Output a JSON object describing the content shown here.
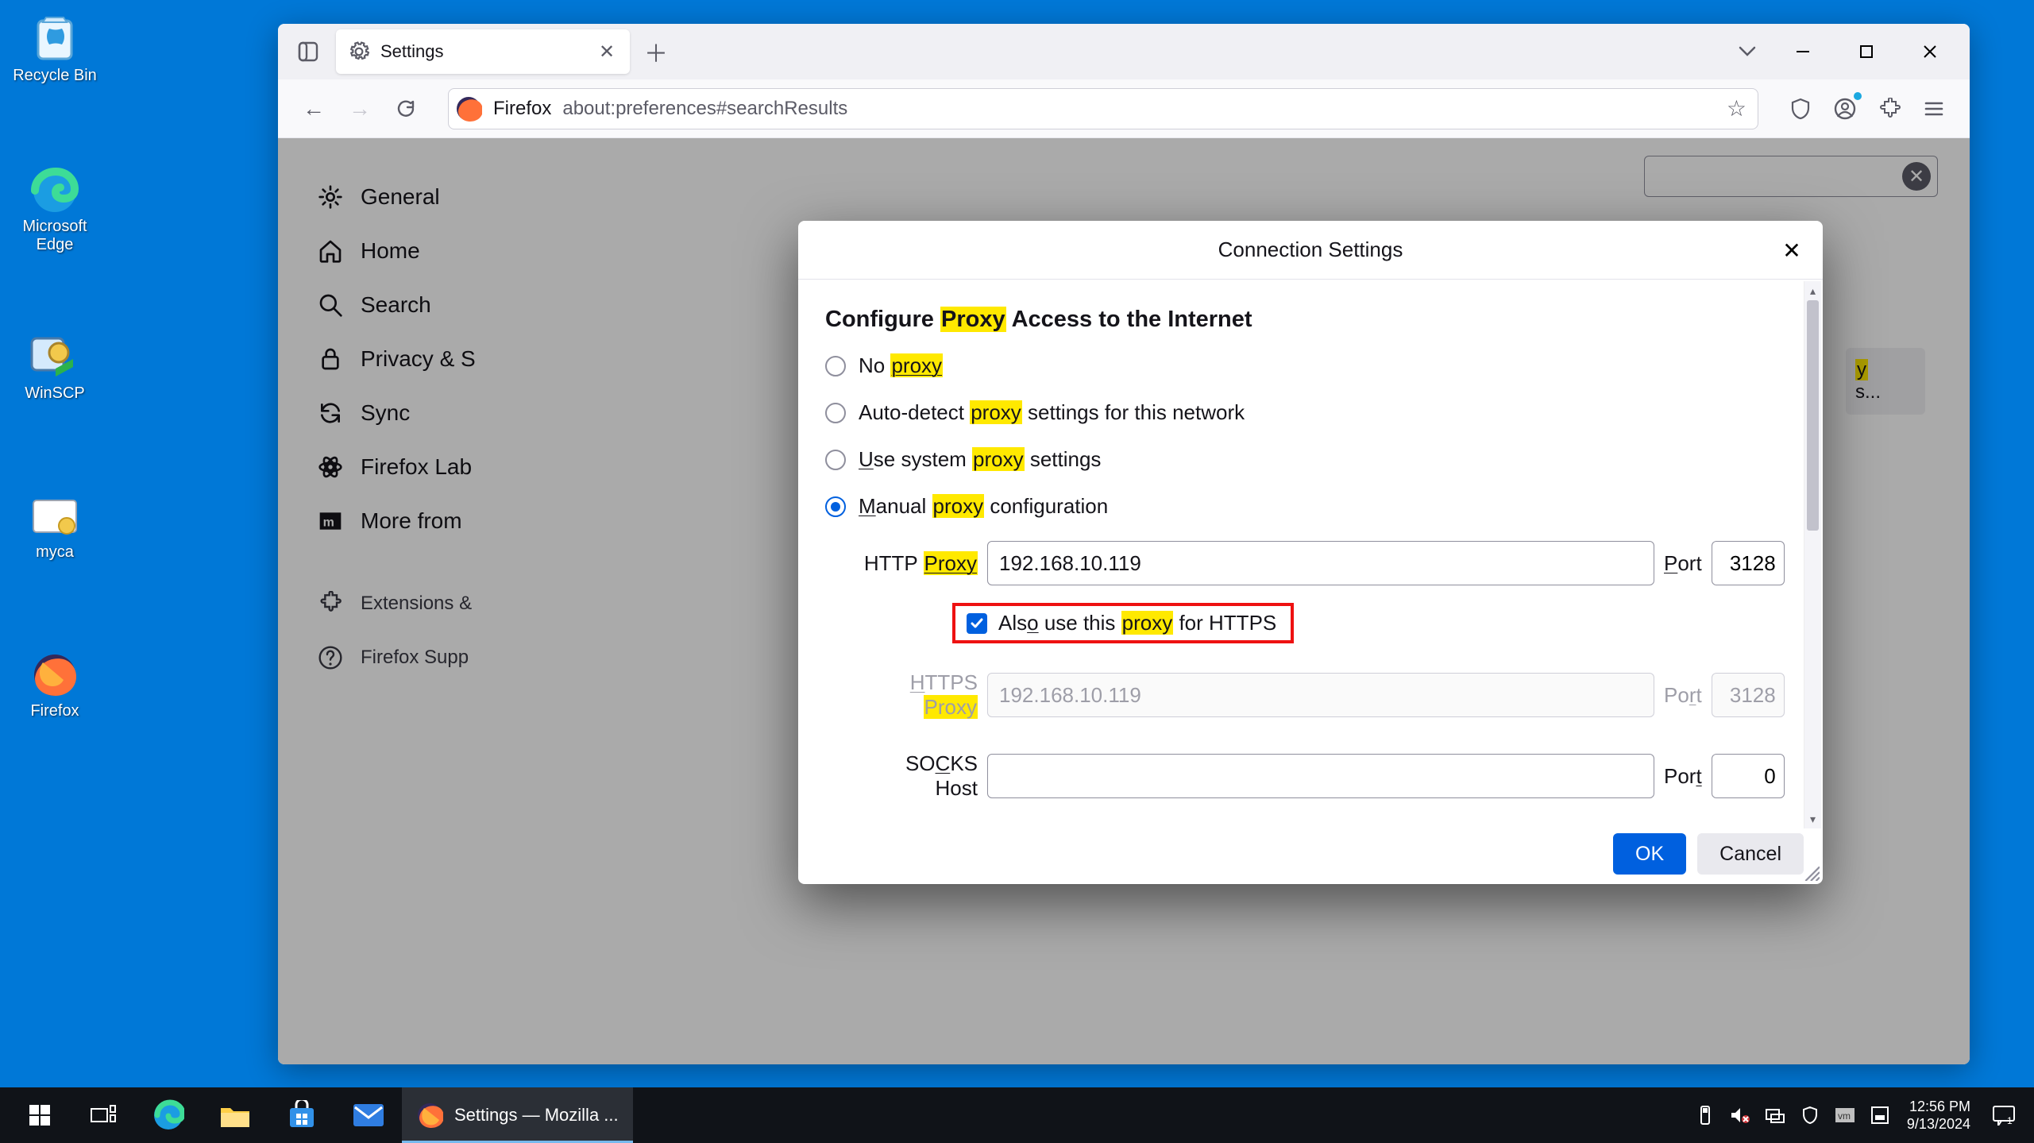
{
  "desktop": {
    "icons": [
      {
        "name": "recycle-bin",
        "label": "Recycle Bin"
      },
      {
        "name": "edge",
        "label": "Microsoft Edge"
      },
      {
        "name": "winscp",
        "label": "WinSCP"
      },
      {
        "name": "myca",
        "label": "myca"
      },
      {
        "name": "firefox",
        "label": "Firefox"
      }
    ]
  },
  "browser": {
    "tab_label": "Settings",
    "url_brand": "Firefox",
    "url": "about:preferences#searchResults"
  },
  "sidebar": {
    "items": [
      "General",
      "Home",
      "Search",
      "Privacy & Security",
      "Sync",
      "Firefox Labs",
      "More from Mozilla"
    ],
    "secondary": [
      "Extensions & Themes",
      "Firefox Support"
    ]
  },
  "search_hint": {
    "hl": "y",
    "rest": "s..."
  },
  "modal": {
    "title": "Connection Settings",
    "heading_pre": "Configure ",
    "heading_hl": "Proxy",
    "heading_post": " Access to the Internet",
    "opts": {
      "noproxy": {
        "pre": "No ",
        "hl": "proxy",
        "post": ""
      },
      "auto": {
        "pre": "Auto-detect ",
        "hl": "proxy",
        "post": " settings for this network"
      },
      "system": {
        "pre": "Use system ",
        "hl": "proxy",
        "post": " settings",
        "accel": "U"
      },
      "manual": {
        "pre": "Manual ",
        "hl": "proxy",
        "post": " configuration",
        "accel": "M"
      }
    },
    "http": {
      "label_pre": "HTTP ",
      "label_hl": "Proxy",
      "value": "192.168.10.119",
      "port_label": "Port",
      "port": "3128",
      "port_accel": "P"
    },
    "also_https": {
      "pre": "Also use this ",
      "hl": "proxy",
      "post": " for HTTPS",
      "accel": "o",
      "checked": true
    },
    "https": {
      "label_pre": "HTTPS ",
      "label_hl": "Proxy",
      "value": "192.168.10.119",
      "port_label": "Port",
      "port": "3128",
      "accel": "H"
    },
    "socks": {
      "label": "SOCKS Host",
      "accel": "C",
      "value": "",
      "port_label": "Port",
      "port": "0",
      "port_accel": "t"
    },
    "ok": "OK",
    "cancel": "Cancel"
  },
  "taskbar": {
    "active": "Settings — Mozilla ...",
    "time": "12:56 PM",
    "date": "9/13/2024"
  }
}
